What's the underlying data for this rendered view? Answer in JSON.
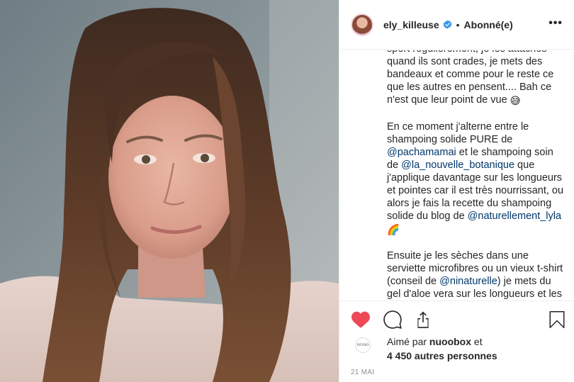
{
  "post": {
    "username": "ely_killeuse",
    "separator": "•",
    "follow_status": "Abonné(e)",
    "more_label": "•••"
  },
  "caption": {
    "p1": [
      {
        "t": "text",
        "v": "sport régulièrement, je les attaches quand ils sont crades, je mets des bandeaux et comme pour le reste ce que les autres en pensent.... Bah ce n'est que leur point de vue "
      },
      {
        "t": "emoji",
        "v": "😅"
      }
    ],
    "p2": [
      {
        "t": "text",
        "v": "En ce moment j'alterne entre le shampoing solide PURE de "
      },
      {
        "t": "mention",
        "v": "@pachamamai"
      },
      {
        "t": "text",
        "v": " et le shampoing soin de "
      },
      {
        "t": "mention",
        "v": "@la_nouvelle_botanique"
      },
      {
        "t": "text",
        "v": " que j'applique davantage sur les longueurs et pointes car il est très nourrissant, ou alors je fais la recette du shampoing solide du blog de "
      },
      {
        "t": "mention",
        "v": "@naturellement_lyla"
      },
      {
        "t": "text",
        "v": " "
      },
      {
        "t": "emoji",
        "v": "🌈"
      }
    ],
    "p3": [
      {
        "t": "text",
        "v": "Ensuite je les sèches dans une serviette microfibres ou un vieux t-shirt (conseil de "
      },
      {
        "t": "mention",
        "v": "@ninaturelle"
      },
      {
        "t": "text",
        "v": ") je mets du gel d'aloe vera sur les longueurs et les laisse sécher à l'air libre "
      },
      {
        "t": "emoji",
        "v": "🆓"
      }
    ]
  },
  "likes": {
    "prefix": "Aimé par ",
    "first_liker": "nuoobox",
    "middle": " et",
    "count": "4 450 autres personnes",
    "liker_avatar_text": "NUOO"
  },
  "date": "21 MAI",
  "colors": {
    "heart": "#ed4956",
    "mention": "#00376b",
    "verified": "#3897f0",
    "muted": "#8e8e8e"
  },
  "icons": [
    "heart-icon",
    "comment-icon",
    "share-icon",
    "bookmark-icon",
    "verified-badge-icon"
  ]
}
